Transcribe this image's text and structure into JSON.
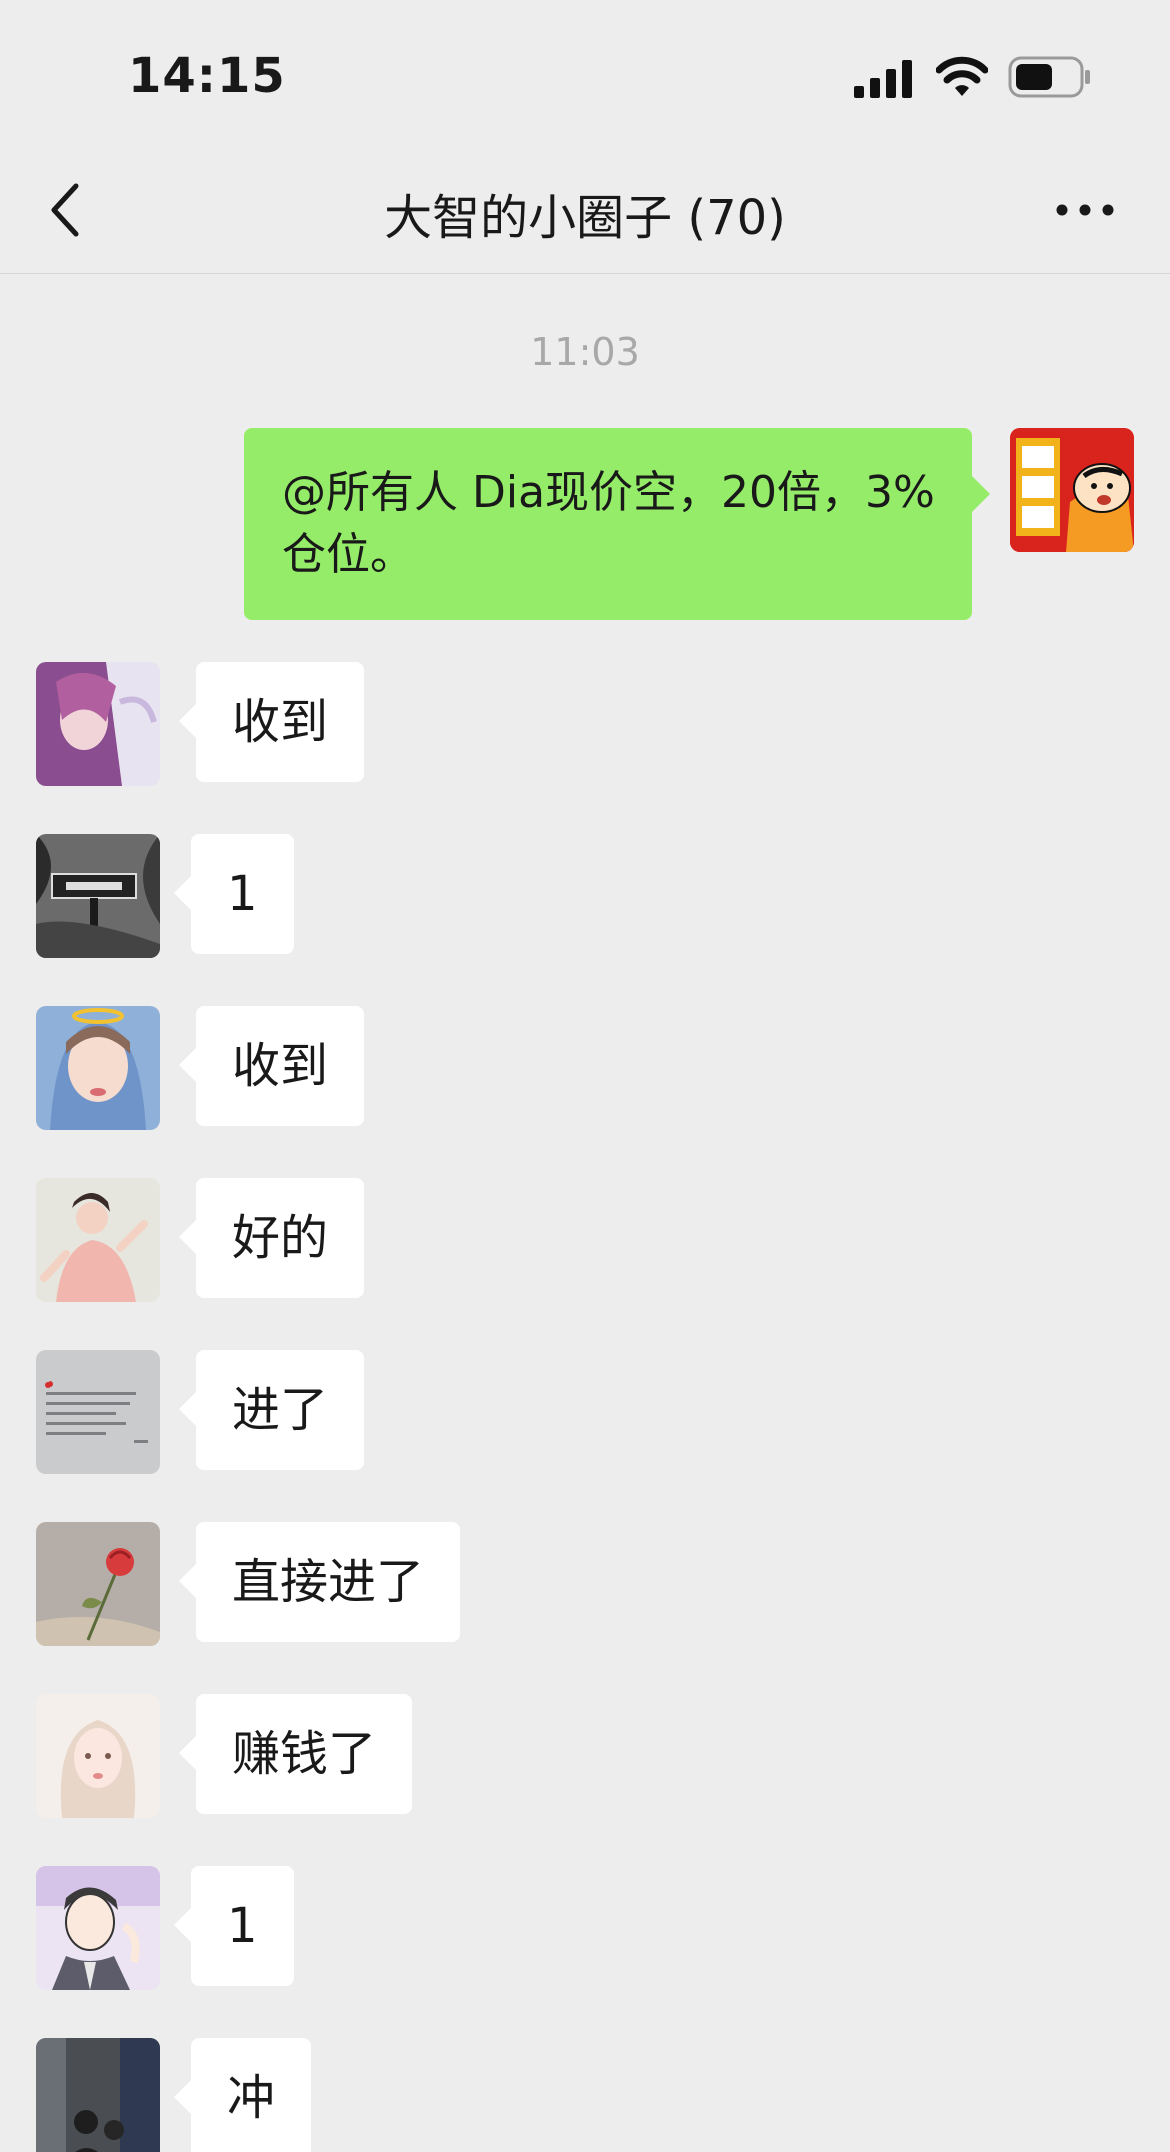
{
  "status_bar": {
    "time": "14:15"
  },
  "nav": {
    "title": "大智的小圈子 (70)"
  },
  "conversation": {
    "timestamp": "11:03",
    "self_message": "@所有人 Dia现价空，20倍，3%仓位。",
    "messages": [
      {
        "text": "收到",
        "avatar": "purple-hair-girl-avatar"
      },
      {
        "text": "1",
        "avatar": "street-sign-avatar"
      },
      {
        "text": "收到",
        "avatar": "halo-girl-avatar"
      },
      {
        "text": "好的",
        "avatar": "dancing-woman-avatar"
      },
      {
        "text": "进了",
        "avatar": "text-note-avatar"
      },
      {
        "text": "直接进了",
        "avatar": "rose-avatar"
      },
      {
        "text": "赚钱了",
        "avatar": "illustrated-girl-avatar"
      },
      {
        "text": "1",
        "avatar": "anime-man-avatar"
      },
      {
        "text": "冲",
        "avatar": "street-photo-avatar"
      }
    ]
  },
  "colors": {
    "background": "#ededed",
    "self_bubble": "#95ec69",
    "other_bubble": "#ffffff",
    "timestamp": "#a8a8a8"
  }
}
